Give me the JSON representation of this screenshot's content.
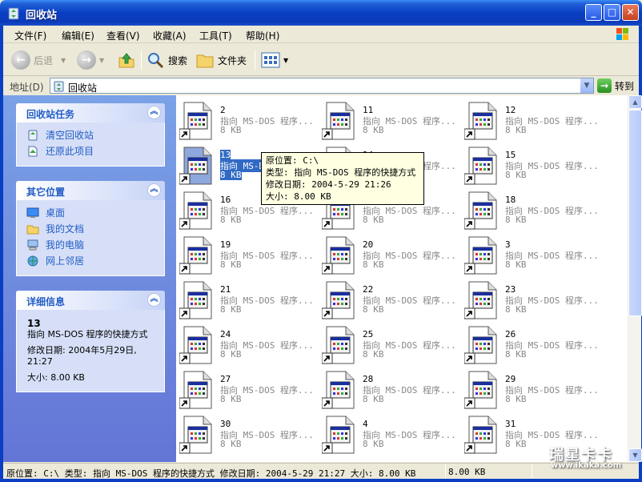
{
  "window": {
    "title": "回收站"
  },
  "menu": [
    "文件(F)",
    "编辑(E)",
    "查看(V)",
    "收藏(A)",
    "工具(T)",
    "帮助(H)"
  ],
  "toolbar": {
    "back": "后退",
    "search": "搜索",
    "folders": "文件夹"
  },
  "address": {
    "label": "地址(D)",
    "value": "回收站",
    "go": "转到"
  },
  "tasks": {
    "title": "回收站任务",
    "items": [
      "清空回收站",
      "还原此项目"
    ]
  },
  "places": {
    "title": "其它位置",
    "items": [
      "桌面",
      "我的文档",
      "我的电脑",
      "网上邻居"
    ]
  },
  "details": {
    "title": "详细信息",
    "name": "13",
    "type": "指向 MS-DOS 程序的快捷方式",
    "modified": "修改日期: 2004年5月29日, 21:27",
    "size": "大小: 8.00 KB"
  },
  "files": [
    {
      "name": "2",
      "type": "指向 MS-DOS 程序...",
      "size": "8 KB"
    },
    {
      "name": "11",
      "type": "指向 MS-DOS 程序...",
      "size": "8 KB"
    },
    {
      "name": "12",
      "type": "指向 MS-DOS 程序...",
      "size": "8 KB"
    },
    {
      "name": "13",
      "type": "指向 MS-DOS 程序...",
      "size": "8 KB",
      "selected": true
    },
    {
      "name": "14",
      "type": "指向 MS-DOS 程序...",
      "size": "8 KB"
    },
    {
      "name": "15",
      "type": "指向 MS-DOS 程序...",
      "size": "8 KB"
    },
    {
      "name": "16",
      "type": "指向 MS-DOS 程序...",
      "size": "8 KB"
    },
    {
      "name": "17",
      "type": "指向 MS-DOS 程序...",
      "size": "8 KB"
    },
    {
      "name": "18",
      "type": "指向 MS-DOS 程序...",
      "size": "8 KB"
    },
    {
      "name": "19",
      "type": "指向 MS-DOS 程序...",
      "size": "8 KB"
    },
    {
      "name": "20",
      "type": "指向 MS-DOS 程序...",
      "size": "8 KB"
    },
    {
      "name": "3",
      "type": "指向 MS-DOS 程序...",
      "size": "8 KB"
    },
    {
      "name": "21",
      "type": "指向 MS-DOS 程序...",
      "size": "8 KB"
    },
    {
      "name": "22",
      "type": "指向 MS-DOS 程序...",
      "size": "8 KB"
    },
    {
      "name": "23",
      "type": "指向 MS-DOS 程序...",
      "size": "8 KB"
    },
    {
      "name": "24",
      "type": "指向 MS-DOS 程序...",
      "size": "8 KB"
    },
    {
      "name": "25",
      "type": "指向 MS-DOS 程序...",
      "size": "8 KB"
    },
    {
      "name": "26",
      "type": "指向 MS-DOS 程序...",
      "size": "8 KB"
    },
    {
      "name": "27",
      "type": "指向 MS-DOS 程序...",
      "size": "8 KB"
    },
    {
      "name": "28",
      "type": "指向 MS-DOS 程序...",
      "size": "8 KB"
    },
    {
      "name": "29",
      "type": "指向 MS-DOS 程序...",
      "size": "8 KB"
    },
    {
      "name": "30",
      "type": "指向 MS-DOS 程序...",
      "size": "8 KB"
    },
    {
      "name": "4",
      "type": "指向 MS-DOS 程序...",
      "size": "8 KB"
    },
    {
      "name": "31",
      "type": "指向 MS-DOS 程序...",
      "size": "8 KB"
    }
  ],
  "tooltip": {
    "location": "原位置: C:\\",
    "type": "类型: 指向 MS-DOS 程序的快捷方式",
    "modified": "修改日期: 2004-5-29 21:26",
    "size": "大小: 8.00 KB"
  },
  "status": {
    "text": "原位置: C:\\ 类型: 指向 MS-DOS 程序的快捷方式 修改日期: 2004-5-29 21:27 大小: 8.00 KB",
    "size": "8.00 KB"
  },
  "watermark": {
    "line1": "瑞星卡卡",
    "line2": "www.ikaka.com"
  }
}
